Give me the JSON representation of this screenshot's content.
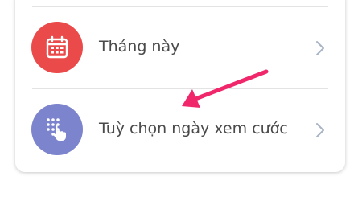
{
  "menu": {
    "items": [
      {
        "label": "Tháng này",
        "icon": "calendar-icon",
        "icon_color": "#ea4a4a"
      },
      {
        "label": "Tuỳ chọn ngày xem cước",
        "icon": "keypad-tap-icon",
        "icon_color": "#7b84cc"
      }
    ]
  },
  "annotation": {
    "arrow_color": "#f0276a"
  },
  "colors": {
    "chevron": "#a8b3c4",
    "divider": "#e3e3e3",
    "label": "#4a4a4a"
  }
}
